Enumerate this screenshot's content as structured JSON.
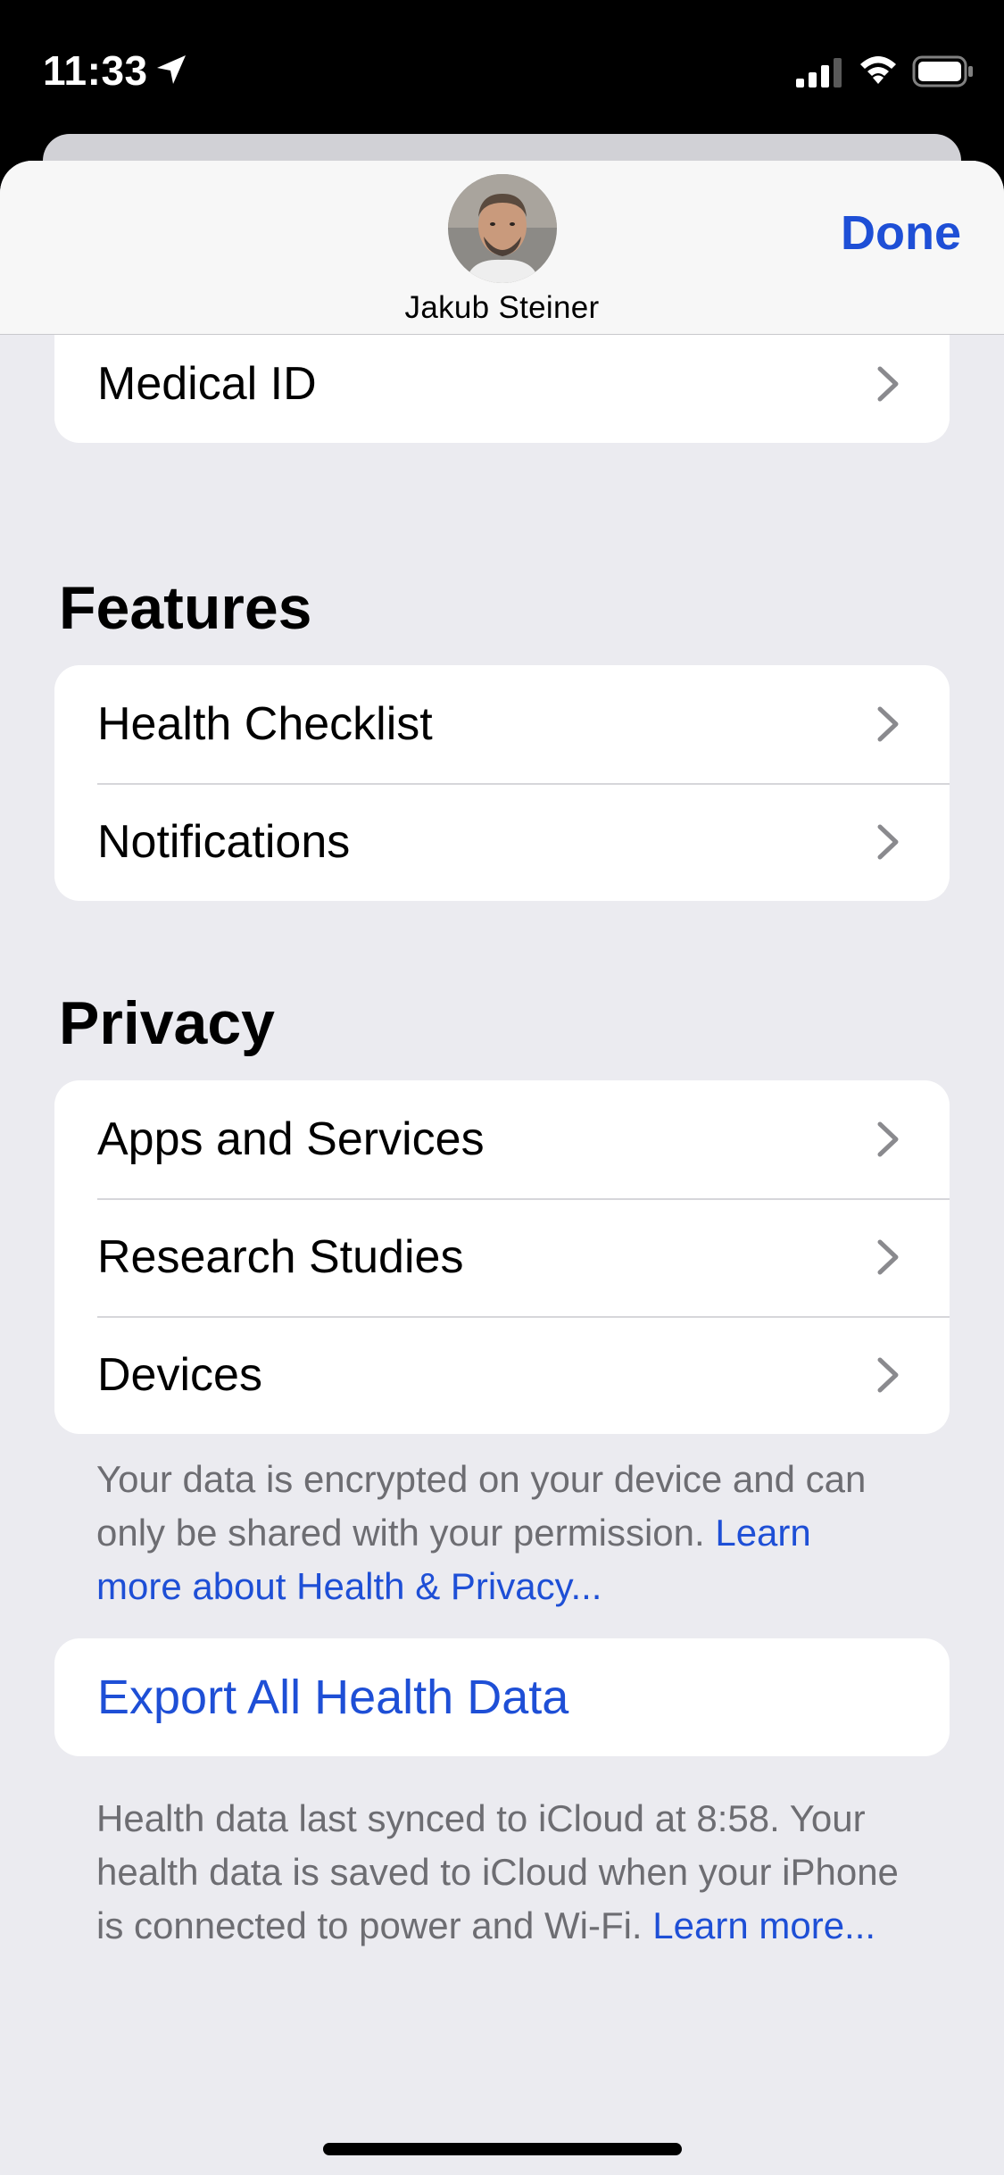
{
  "status_bar": {
    "time": "11:33"
  },
  "header": {
    "profile_name": "Jakub Steiner",
    "done_label": "Done"
  },
  "top_card": {
    "items": [
      {
        "label": "Medical ID"
      }
    ]
  },
  "features": {
    "title": "Features",
    "items": [
      {
        "label": "Health Checklist"
      },
      {
        "label": "Notifications"
      }
    ]
  },
  "privacy": {
    "title": "Privacy",
    "items": [
      {
        "label": "Apps and Services"
      },
      {
        "label": "Research Studies"
      },
      {
        "label": "Devices"
      }
    ],
    "footnote_text": "Your data is encrypted on your device and can only be shared with your permission.",
    "footnote_link": "Learn more about Health & Privacy..."
  },
  "export": {
    "label": "Export All Health Data",
    "footnote_text": "Health data last synced to iCloud at 8:58. Your health data is saved to iCloud when your iPhone is connected to power and Wi-Fi.",
    "footnote_link": "Learn more..."
  },
  "colors": {
    "accent": "#1e4fd6",
    "background": "#ebebf0",
    "card": "#ffffff",
    "secondary_text": "#6d6d72"
  }
}
